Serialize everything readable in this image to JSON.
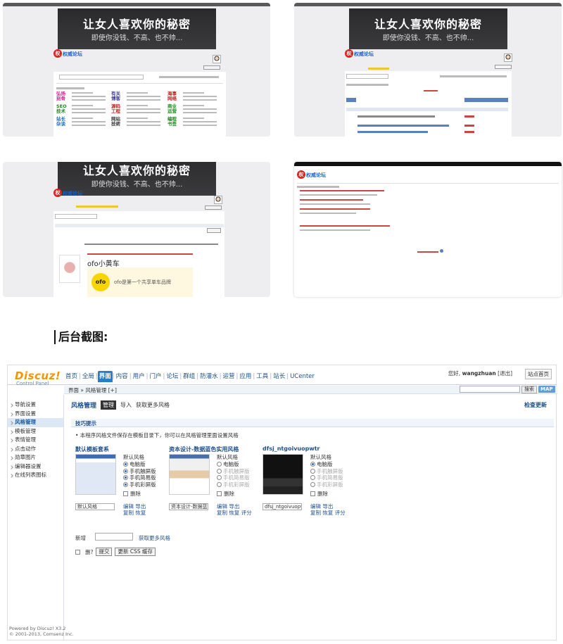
{
  "screens": {
    "banner_line1": "让女人喜欢你的秘密",
    "banner_line2": "即使你没钱、不高、也不帅...",
    "logo_text": "权威论坛",
    "g1_categories": [
      {
        "text": "弘扬\n刻骨",
        "color": "#d81e8f"
      },
      {
        "text": "SEO\n技术",
        "color": "#1c8c20"
      },
      {
        "text": "站长\n杂谈",
        "color": "#1b6ac8"
      },
      {
        "text": "有关\n博客",
        "color": "#3b3b9b"
      },
      {
        "text": "源码\n工程",
        "color": "#c41f1f"
      },
      {
        "text": "网站\n技術",
        "color": "#333333"
      },
      {
        "text": "海事\n网络",
        "color": "#c41f1f"
      },
      {
        "text": "商业\n运营",
        "color": "#1c8c20"
      },
      {
        "text": "编程\n书签",
        "color": "#1c8c20"
      }
    ],
    "g3_ofo": "ofo小黄车",
    "g3_ofo_caption": "ofo是第一个共享单车品牌"
  },
  "heading": "后台截图:",
  "admin": {
    "logo": "Discuz!",
    "logo_sub": "Control Panel",
    "nav": [
      "首页",
      "全局",
      "界面",
      "内容",
      "用户",
      "门户",
      "论坛",
      "群组",
      "防灌水",
      "运营",
      "应用",
      "工具",
      "站长",
      "UCenter"
    ],
    "nav_active": "界面",
    "user_label": "您好,",
    "user_name": "wangzhuan",
    "logout": "[退出]",
    "home_button": "站点首页",
    "breadcrumb": "界面 » 风格管理  [+]",
    "search_button": "搜索",
    "map_button": "MAP",
    "sidebar": [
      "导航设置",
      "界面设置",
      "风格管理",
      "模板管理",
      "表情管理",
      "点击动作",
      "勋章图片",
      "编辑器设置",
      "在线列表图标"
    ],
    "sidebar_active": "风格管理",
    "footer_line1": "Powered by Discuz! X3.2",
    "footer_line2": "© 2001-2013, Comsenz Inc.",
    "page_heading": "风格管理",
    "tabs": [
      "管理",
      "导入",
      "获取更多风格"
    ],
    "tab_active": "管理",
    "reset_link": "检查更新",
    "tip_title": "技巧提示",
    "tip_text": "• 本程序风格文件保存在模板目录下，你可以在风格管理里面设置风格",
    "styles": [
      {
        "name": "默认模板套系",
        "options": [
          "默认风格",
          "电脑版",
          "手机触屏版",
          "手机简易版",
          "手机彩屏版"
        ],
        "selected": [
          1,
          2,
          3,
          4
        ],
        "disabled": [],
        "checkbox": "删除",
        "field": "默认风格",
        "links": [
          "编辑",
          "导出",
          "复制",
          "恢复"
        ]
      },
      {
        "name": "资本设计-数据蓝色实用风格",
        "options": [
          "默认风格",
          "电脑版",
          "手机触屏版",
          "手机简易版",
          "手机彩屏版"
        ],
        "selected": [],
        "disabled": [
          2,
          3,
          4
        ],
        "checkbox": "删除",
        "field": "资本设计-数据蓝色",
        "links": [
          "编辑",
          "导出",
          "复制",
          "恢复",
          "评分"
        ]
      },
      {
        "name": "dfsj_ntgoivuopwtr",
        "options": [
          "默认风格",
          "电脑版",
          "手机触屏版",
          "手机简易版",
          "手机彩屏版"
        ],
        "selected": [
          1
        ],
        "disabled": [
          2,
          3,
          4
        ],
        "checkbox": "删除",
        "field": "dfsj_ntgoivuopw",
        "links": [
          "编辑",
          "导出",
          "复制",
          "恢复",
          "评分"
        ]
      }
    ],
    "new_label": "新增",
    "get_more": "获取更多风格",
    "delete_label": "删?",
    "submit_button": "提交",
    "css_button": "更新 CSS 缓存"
  }
}
